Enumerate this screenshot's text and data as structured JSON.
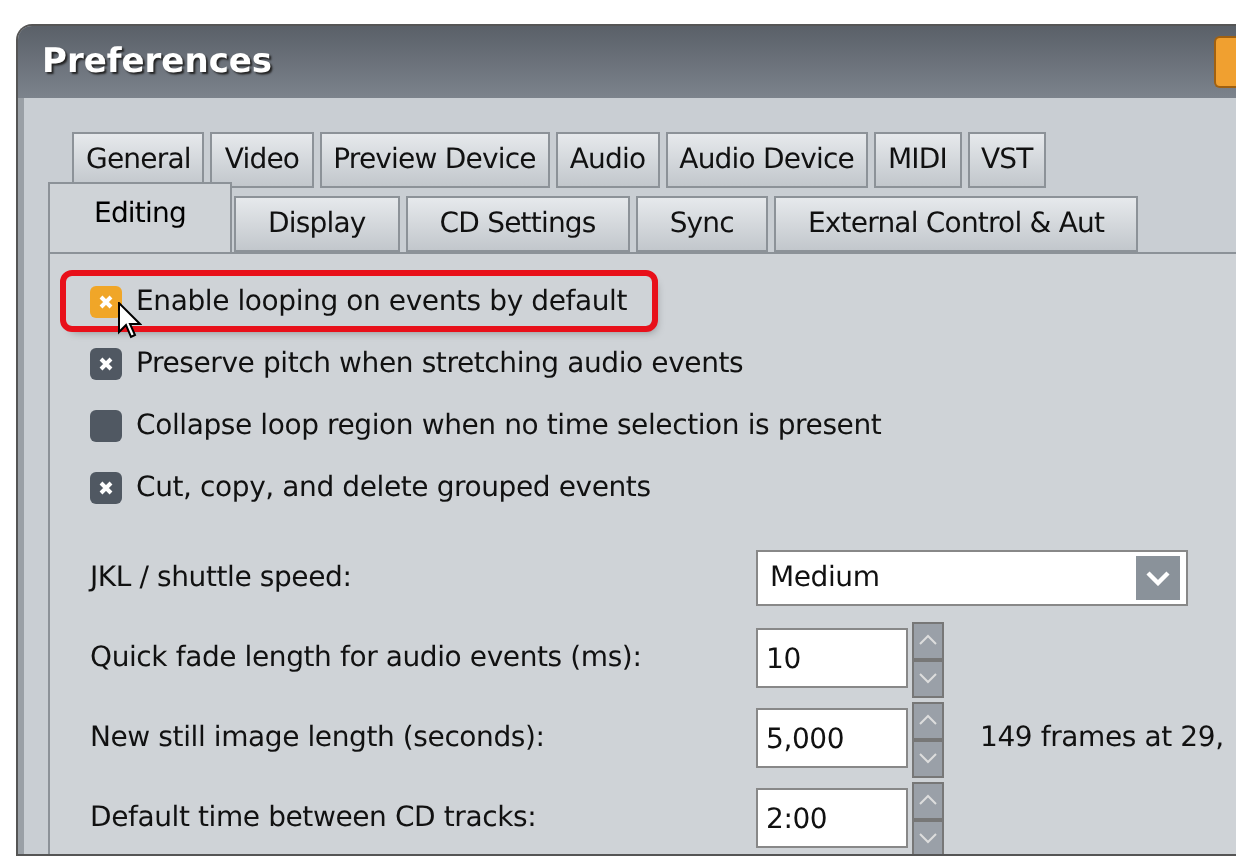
{
  "window": {
    "title": "Preferences"
  },
  "tab_rows": [
    [
      {
        "label": "General",
        "selected": false
      },
      {
        "label": "Video",
        "selected": false
      },
      {
        "label": "Preview Device",
        "selected": false
      },
      {
        "label": "Audio",
        "selected": false
      },
      {
        "label": "Audio Device",
        "selected": false
      },
      {
        "label": "MIDI",
        "selected": false
      },
      {
        "label": "VST",
        "selected": false
      }
    ],
    [
      {
        "label": "Editing",
        "selected": true
      },
      {
        "label": "Display",
        "selected": false
      },
      {
        "label": "CD Settings",
        "selected": false
      },
      {
        "label": "Sync",
        "selected": false
      },
      {
        "label": "External Control & Aut",
        "selected": false
      }
    ]
  ],
  "options": [
    {
      "label": "Enable looping on events by default",
      "checked": true,
      "highlighted": true
    },
    {
      "label": "Preserve pitch when stretching audio events",
      "checked": true,
      "highlighted": false
    },
    {
      "label": "Collapse loop region when no time selection is present",
      "checked": false,
      "highlighted": false
    },
    {
      "label": "Cut, copy, and delete grouped events",
      "checked": true,
      "highlighted": false
    }
  ],
  "settings": [
    {
      "kind": "dropdown",
      "label": "JKL / shuttle speed:",
      "value": "Medium"
    },
    {
      "kind": "spinner",
      "label": "Quick fade length for audio events (ms):",
      "value": "10"
    },
    {
      "kind": "spinner",
      "label": "New still image length (seconds):",
      "value": "5,000",
      "note": "149 frames at 29,"
    },
    {
      "kind": "spinner",
      "label": "Default time between CD tracks:",
      "value": "2:00"
    }
  ]
}
